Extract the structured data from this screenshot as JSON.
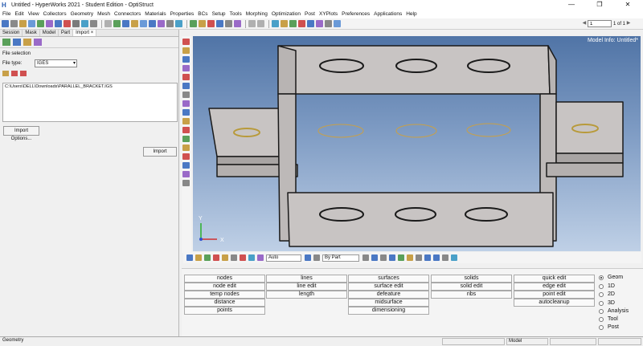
{
  "window": {
    "title": "Untitled - HyperWorks 2021 - Student Edition - OptiStruct",
    "app_icon": "H",
    "controls": [
      "—",
      "❐",
      "✕"
    ]
  },
  "menu": [
    "File",
    "Edit",
    "View",
    "Collectors",
    "Geometry",
    "Mesh",
    "Connectors",
    "Materials",
    "Properties",
    "BCs",
    "Setup",
    "Tools",
    "Morphing",
    "Optimization",
    "Post",
    "XYPlots",
    "Preferences",
    "Applications",
    "Help"
  ],
  "pager": {
    "value": "1",
    "total_label": "1 of 1"
  },
  "browser_tabs": [
    "Session",
    "Mask",
    "Model",
    "Part",
    "Import ×"
  ],
  "import_panel": {
    "file_selection_label": "File selection",
    "file_type_label": "File type:",
    "file_type_value": "IGES",
    "file_path": "C:\\Users\\DELL\\Downloads\\PARALLEL_BRACKET.IGS",
    "import_options_label": "Import Options...",
    "import_label": "Import"
  },
  "viewport": {
    "model_info": "Model Info: Untitled*",
    "axis_x": "X",
    "axis_y": "Y",
    "bg_top": "#5074a6",
    "bg_bottom": "#bfd0e6",
    "part_color": "#c8c4c3"
  },
  "bottom_toolbar": {
    "auto_label": "Auto",
    "by_part_label": "By Part"
  },
  "geom_panel": {
    "col1": [
      "nodes",
      "node edit",
      "temp nodes",
      "distance",
      "points"
    ],
    "col2": [
      "lines",
      "line edit",
      "length"
    ],
    "col3": [
      "surfaces",
      "surface edit",
      "defeature",
      "midsurface",
      "dimensioning"
    ],
    "col4": [
      "solids",
      "solid edit",
      "ribs"
    ],
    "col5": [
      "quick edit",
      "edge edit",
      "point edit",
      "autocleanup"
    ],
    "radios": [
      "Geom",
      "1D",
      "2D",
      "3D",
      "Analysis",
      "Tool",
      "Post"
    ],
    "selected_radio": "Geom"
  },
  "status": {
    "left": "Geometry",
    "model": "Model"
  }
}
